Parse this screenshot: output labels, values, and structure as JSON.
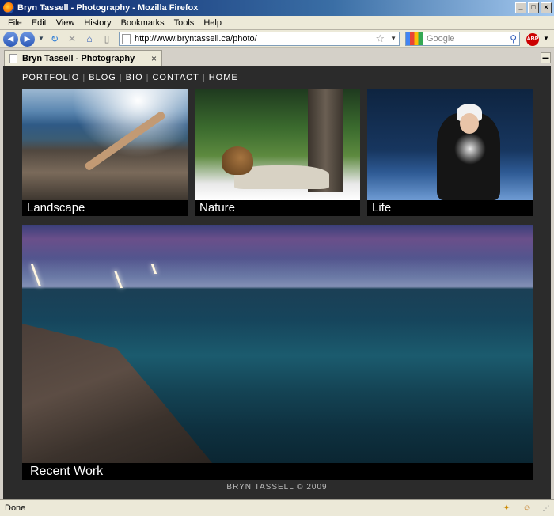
{
  "window": {
    "title": "Bryn Tassell - Photography - Mozilla Firefox",
    "controls": [
      "_",
      "□",
      "×"
    ]
  },
  "menu": [
    "File",
    "Edit",
    "View",
    "History",
    "Bookmarks",
    "Tools",
    "Help"
  ],
  "toolbar": {
    "url": "http://www.bryntassell.ca/photo/",
    "search_placeholder": "Google"
  },
  "tab": {
    "title": "Bryn Tassell - Photography",
    "close": "×"
  },
  "site": {
    "nav": [
      "PORTFOLIO",
      "BLOG",
      "BIO",
      "CONTACT",
      "HOME"
    ],
    "galleries": {
      "landscape": "Landscape",
      "nature": "Nature",
      "life": "Life",
      "recent": "Recent Work"
    },
    "footer": "BRYN TASSELL © 2009"
  },
  "status": {
    "text": "Done",
    "abp": "ABP"
  },
  "colors": {
    "page_bg": "#2b2b2b",
    "caption_bg": "#000000",
    "nav_text": "#ffffff"
  }
}
